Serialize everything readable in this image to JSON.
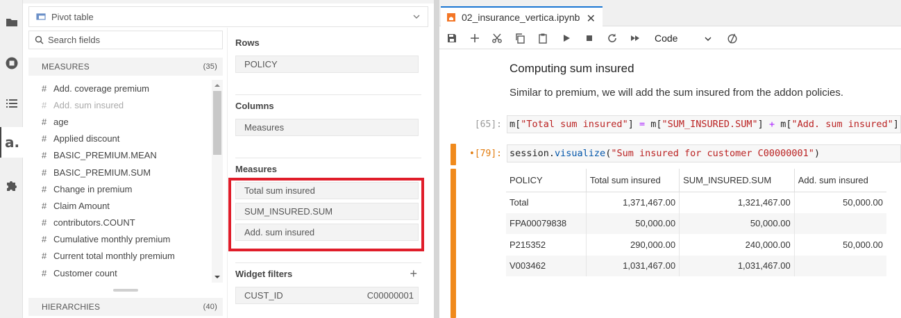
{
  "activity_bar": {
    "icons": [
      "folder-icon",
      "stop-circle-icon",
      "list-icon",
      "atoti-logo-icon",
      "puzzle-icon"
    ],
    "logo_text": "a."
  },
  "pivot": {
    "select_value": "Pivot table",
    "search_placeholder": "Search fields",
    "measures_header": "MEASURES",
    "measures_count": "(35)",
    "hierarchies_header": "HIERARCHIES",
    "hierarchies_count": "(40)",
    "fields": [
      {
        "label": "Add. coverage premium",
        "dim": false
      },
      {
        "label": "Add. sum insured",
        "dim": true
      },
      {
        "label": "age",
        "dim": false
      },
      {
        "label": "Applied discount",
        "dim": false
      },
      {
        "label": "BASIC_PREMIUM.MEAN",
        "dim": false
      },
      {
        "label": "BASIC_PREMIUM.SUM",
        "dim": false
      },
      {
        "label": "Change in premium",
        "dim": false
      },
      {
        "label": "Claim Amount",
        "dim": false
      },
      {
        "label": "contributors.COUNT",
        "dim": false
      },
      {
        "label": "Cumulative monthly premium",
        "dim": false
      },
      {
        "label": "Current total monthly premium",
        "dim": false
      },
      {
        "label": "Customer count",
        "dim": false
      }
    ],
    "hash_symbol": "#"
  },
  "layout_panel": {
    "rows_title": "Rows",
    "rows_items": [
      "POLICY"
    ],
    "columns_title": "Columns",
    "columns_items": [
      "Measures"
    ],
    "measures_title": "Measures",
    "measures_items": [
      "Total sum insured",
      "SUM_INSURED.SUM",
      "Add. sum insured"
    ],
    "filters_title": "Widget filters",
    "filter_field": "CUST_ID",
    "filter_value": "C00000001",
    "plus": "+",
    "highlight_color": "#e01d2a"
  },
  "notebook": {
    "tab_title": "02_insurance_vertica.ipynb",
    "tab_close": "✕",
    "cell_type": "Code",
    "md_heading": "Computing sum insured",
    "md_text": "Similar to premium, we will add the sum insured from the addon policies.",
    "cell1_prompt": "[65]:",
    "cell2_prompt": "•[79]:",
    "cell1_code": {
      "a": "m[",
      "b": "\"Total sum insured\"",
      "c": "] ",
      "d": "=",
      "e": " m[",
      "f": "\"SUM_INSURED.SUM\"",
      "g": "] ",
      "h": "+",
      "i": " m[",
      "j": "\"Add. sum insured\"",
      "k": "]"
    },
    "cell2_code": {
      "a": "session.",
      "b": "visualize",
      "c": "(",
      "d": "\"Sum insured for customer C00000001\"",
      "e": ")"
    },
    "accent_color": "#f08a1c",
    "table": {
      "headers": [
        "POLICY",
        "Total sum insured",
        "SUM_INSURED.SUM",
        "Add. sum insured"
      ],
      "rows": [
        [
          "Total",
          "1,371,467.00",
          "1,321,467.00",
          "50,000.00"
        ],
        [
          "FPA00079838",
          "50,000.00",
          "50,000.00",
          ""
        ],
        [
          "P215352",
          "290,000.00",
          "240,000.00",
          "50,000.00"
        ],
        [
          "V003462",
          "1,031,467.00",
          "1,031,467.00",
          ""
        ]
      ]
    }
  }
}
